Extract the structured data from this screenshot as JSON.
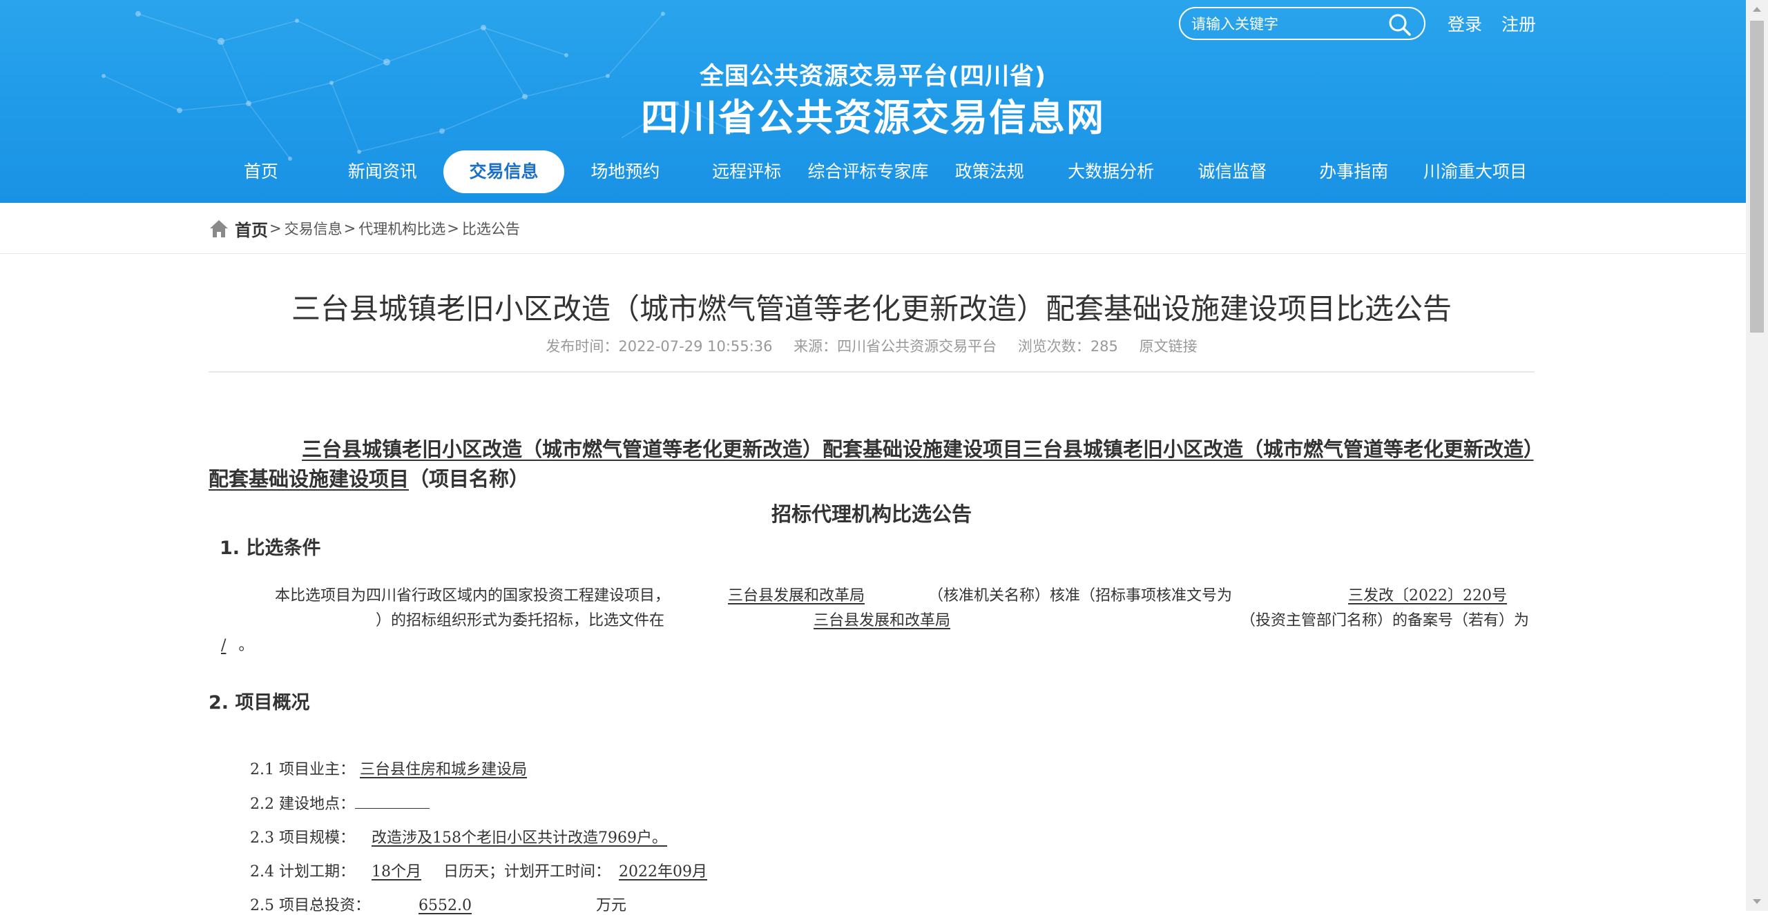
{
  "header": {
    "search_placeholder": "请输入关键字",
    "login_label": "登录",
    "register_label": "注册",
    "platform_title": "全国公共资源交易平台(四川省)",
    "site_title": "四川省公共资源交易信息网",
    "nav": [
      {
        "label": "首页"
      },
      {
        "label": "新闻资讯"
      },
      {
        "label": "交易信息",
        "active": true
      },
      {
        "label": "场地预约"
      },
      {
        "label": "远程评标"
      },
      {
        "label": "综合评标专家库"
      },
      {
        "label": "政策法规"
      },
      {
        "label": "大数据分析"
      },
      {
        "label": "诚信监督"
      },
      {
        "label": "办事指南"
      },
      {
        "label": "川渝重大项目"
      }
    ]
  },
  "breadcrumb": {
    "home": "首页",
    "items": [
      "交易信息",
      "代理机构比选",
      "比选公告"
    ],
    "separator": ">"
  },
  "article": {
    "title": "三台县城镇老旧小区改造（城市燃气管道等老化更新改造）配套基础设施建设项目比选公告",
    "meta": {
      "publish_label": "发布时间：",
      "publish_time": "2022-07-29 10:55:36",
      "source_label": "来源：",
      "source": "四川省公共资源交易平台",
      "views_label": "浏览次数：",
      "views": "285",
      "original_link": "原文链接"
    },
    "project_name_line": "三台县城镇老旧小区改造（城市燃气管道等老化更新改造）配套基础设施建设项目三台县城镇老旧小区改造（城市燃气管道等老化更新改造）配套基础设施建设项目",
    "project_name_suffix": "（项目名称）",
    "notice_heading": "招标代理机构比选公告",
    "section1": {
      "heading": "1.  比选条件",
      "p_1": "本比选项目为四川省行政区域内的国家投资工程建设项目，",
      "approval_org": "三台县发展和改革局",
      "p_2": "（核准机关名称）核准（招标事项核准文号为",
      "approval_no": "三发改〔2022〕220号",
      "p_3": "）的招标组织形式为委托招标，比选文件在",
      "record_org": "三台县发展和改革局",
      "p_4": "（投资主管部门名称）的备案号（若有）为",
      "record_no": "/",
      "p_5": "。"
    },
    "section2": {
      "heading": "2.  项目概况",
      "items": [
        {
          "label": "2.1 项目业主：",
          "value": "三台县住房和城乡建设局"
        },
        {
          "label": "2.2 建设地点：",
          "value": ""
        },
        {
          "label": "2.3 项目规模：",
          "value": "改造涉及158个老旧小区共计改造7969户。"
        },
        {
          "label": "2.4 计划工期：",
          "value": "18个月",
          "mid": "日历天；计划开工时间：",
          "value2": "2022年09月"
        },
        {
          "label": "2.5 项目总投资：",
          "value": "6552.0",
          "suffix": "万元"
        }
      ]
    }
  }
}
